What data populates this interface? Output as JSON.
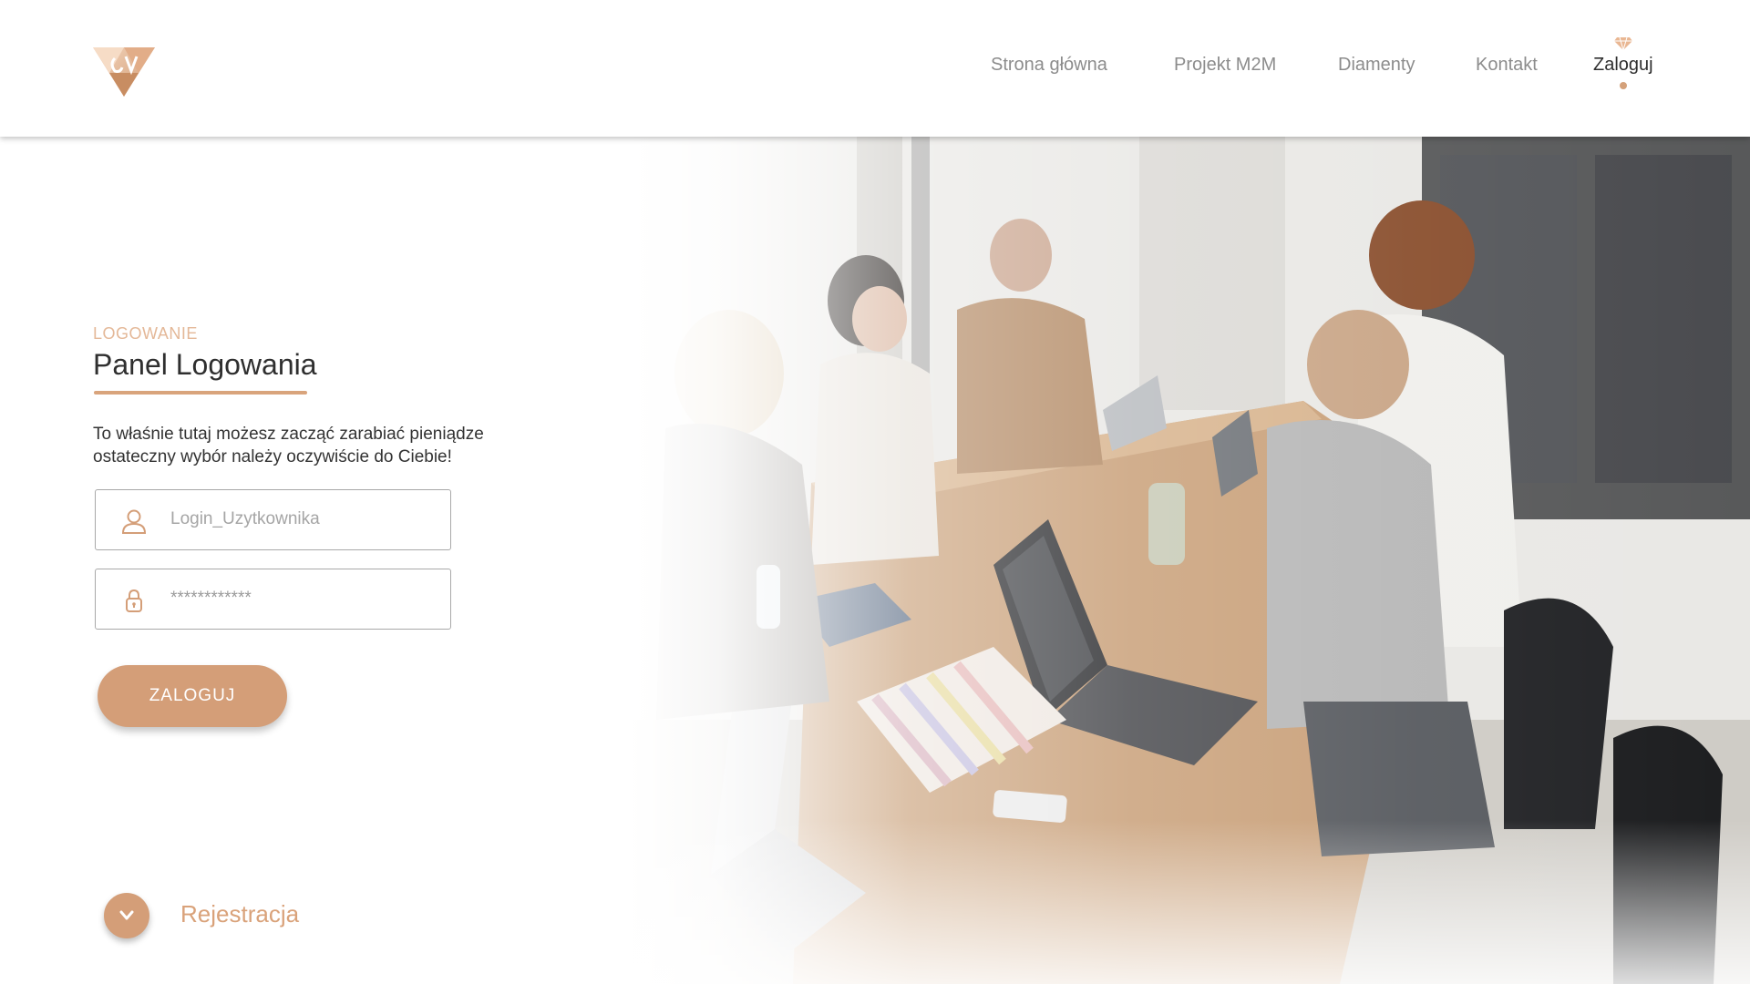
{
  "header": {
    "logo_name": "diamond-monogram-logo",
    "nav": [
      {
        "label": "Strona główna",
        "active": false
      },
      {
        "label": "Projekt M2M",
        "active": false
      },
      {
        "label": "Diamenty",
        "active": false
      },
      {
        "label": "Kontakt",
        "active": false
      },
      {
        "label": "Zaloguj",
        "active": true
      }
    ]
  },
  "login": {
    "eyebrow": "LOGOWANIE",
    "title": "Panel Logowania",
    "description_line1": "To właśnie tutaj możesz zacząć zarabiać pieniądze",
    "description_line2": "ostateczny wybór należy oczywiście do Ciebie!",
    "username_placeholder": "Login_Uzytkownika",
    "password_value": "************",
    "button_label": "ZALOGUJ",
    "register_label": "Rejestracja"
  },
  "icons": {
    "user": "user-icon",
    "lock": "lock-icon",
    "diamond": "diamond-icon",
    "chevron": "chevron-down-icon"
  },
  "colors": {
    "accent": "#d49e78",
    "accent_light": "#e4b898",
    "text_dark": "#2f2f2f",
    "nav_text": "#8c8c8c"
  }
}
